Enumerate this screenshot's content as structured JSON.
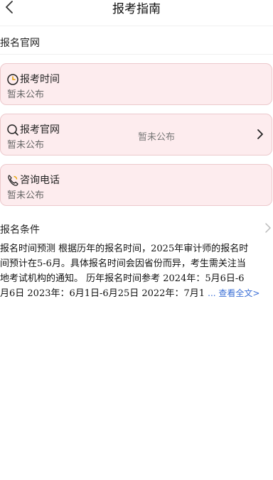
{
  "header": {
    "title": "报考指南"
  },
  "sections": {
    "website_label": "报名官网",
    "conditions_label": "报名条件"
  },
  "cards": [
    {
      "title": "报考时间",
      "value": "暂未公布",
      "icon": "clock-icon"
    },
    {
      "title": "报考官网",
      "value": "暂未公布",
      "center_value": "暂未公布",
      "icon": "search-icon"
    },
    {
      "title": "咨询电话",
      "value": "暂未公布",
      "icon": "phone-icon"
    }
  ],
  "conditions": {
    "lines": [
      "报名时间预测 根据历年的报名时间，2025年审计师的报名时",
      "间预计在5-6月。具体报名时间会因省份而异，考生需关注当",
      "地考试机构的通知。 历年报名时间参考 2024年：5月6日-6",
      "月6日 2023年：6月1日-6月25日 2022年：7月1"
    ],
    "more_link": "... 查看全文>"
  },
  "colors": {
    "card_bg": "#fdecee",
    "card_border": "#ecc9cc",
    "link": "#3b6fd6"
  }
}
